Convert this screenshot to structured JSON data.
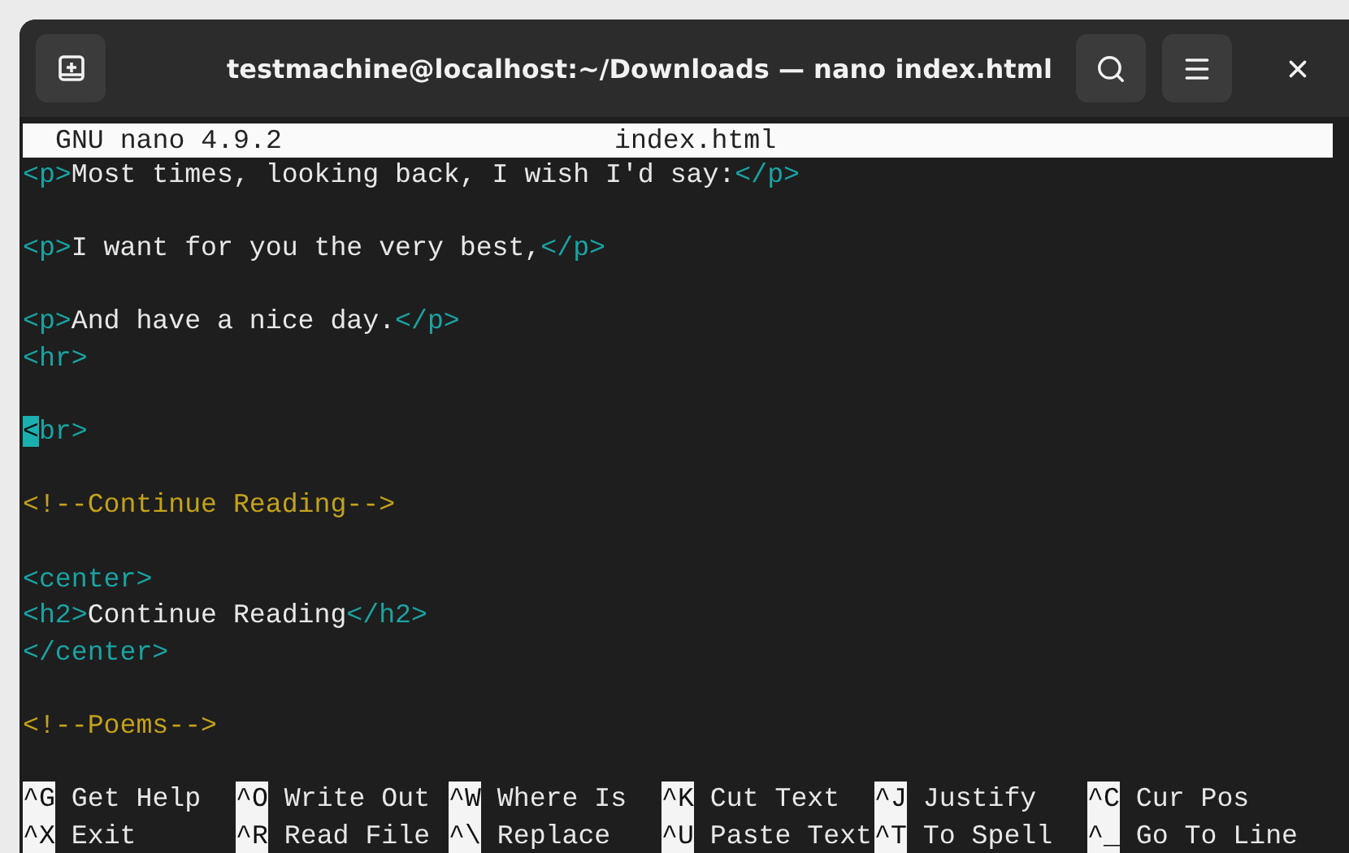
{
  "window": {
    "title": "testmachine@localhost:~/Downloads — nano index.html"
  },
  "nano": {
    "version": "GNU nano 4.9.2",
    "filename": "index.html"
  },
  "lines": [
    {
      "kind": "code",
      "segments": [
        {
          "kind": "tag",
          "text": "<p>"
        },
        {
          "kind": "text",
          "text": "Most times, looking back, I wish I'd say:"
        },
        {
          "kind": "tag",
          "text": "</p>"
        }
      ]
    },
    {
      "kind": "blank"
    },
    {
      "kind": "code",
      "segments": [
        {
          "kind": "tag",
          "text": "<p>"
        },
        {
          "kind": "text",
          "text": "I want for you the very best,"
        },
        {
          "kind": "tag",
          "text": "</p>"
        }
      ]
    },
    {
      "kind": "blank"
    },
    {
      "kind": "code",
      "segments": [
        {
          "kind": "tag",
          "text": "<p>"
        },
        {
          "kind": "text",
          "text": "And have a nice day."
        },
        {
          "kind": "tag",
          "text": "</p>"
        }
      ]
    },
    {
      "kind": "code",
      "segments": [
        {
          "kind": "tag",
          "text": "<hr>"
        }
      ]
    },
    {
      "kind": "blank"
    },
    {
      "kind": "code",
      "segments": [
        {
          "kind": "cursor",
          "text": "<"
        },
        {
          "kind": "tag",
          "text": "br>"
        }
      ]
    },
    {
      "kind": "blank"
    },
    {
      "kind": "code",
      "segments": [
        {
          "kind": "comment",
          "text": "<!--Continue Reading-->"
        }
      ]
    },
    {
      "kind": "blank"
    },
    {
      "kind": "code",
      "segments": [
        {
          "kind": "tag",
          "text": "<center>"
        }
      ]
    },
    {
      "kind": "code",
      "segments": [
        {
          "kind": "tag",
          "text": "<h2>"
        },
        {
          "kind": "text",
          "text": "Continue Reading"
        },
        {
          "kind": "tag",
          "text": "</h2>"
        }
      ]
    },
    {
      "kind": "code",
      "segments": [
        {
          "kind": "tag",
          "text": "</center>"
        }
      ]
    },
    {
      "kind": "blank"
    },
    {
      "kind": "code",
      "segments": [
        {
          "kind": "comment",
          "text": "<!--Poems-->"
        }
      ]
    },
    {
      "kind": "blank"
    }
  ],
  "shortcut_rows": [
    [
      {
        "key": "^G",
        "label": "Get Help"
      },
      {
        "key": "^O",
        "label": "Write Out"
      },
      {
        "key": "^W",
        "label": "Where Is"
      },
      {
        "key": "^K",
        "label": "Cut Text"
      },
      {
        "key": "^J",
        "label": "Justify"
      },
      {
        "key": "^C",
        "label": "Cur Pos"
      }
    ],
    [
      {
        "key": "^X",
        "label": "Exit"
      },
      {
        "key": "^R",
        "label": "Read File"
      },
      {
        "key": "^\\",
        "label": "Replace"
      },
      {
        "key": "^U",
        "label": "Paste Text"
      },
      {
        "key": "^T",
        "label": "To Spell"
      },
      {
        "key": "^_",
        "label": "Go To Line"
      }
    ]
  ]
}
